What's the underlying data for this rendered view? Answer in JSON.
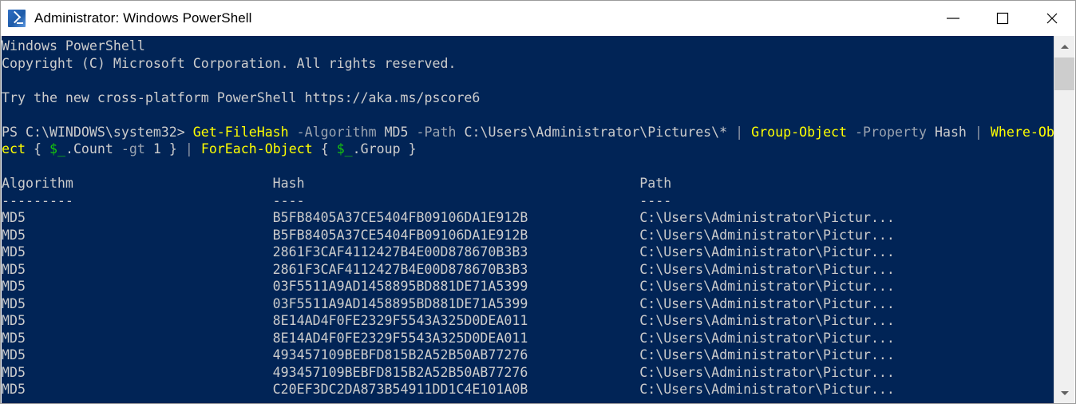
{
  "window": {
    "title": "Administrator: Windows PowerShell",
    "icon": "powershell-icon",
    "background_color": "#012456",
    "controls": {
      "minimize": "minimize-button",
      "maximize": "maximize-button",
      "close": "close-button"
    }
  },
  "colors": {
    "console_background": "#012456",
    "default_text": "#cccccc",
    "command": "#ffff00",
    "parameter": "#9aa3b0",
    "variable": "#16c60c",
    "titlebar_background": "#ffffff",
    "scrollbar_track": "#f0f0f0",
    "scrollbar_thumb": "#cdcdcd"
  },
  "console": {
    "banner": [
      "Windows PowerShell",
      "Copyright (C) Microsoft Corporation. All rights reserved.",
      "",
      "Try the new cross-platform PowerShell https://aka.ms/pscore6",
      ""
    ],
    "prompt": "PS C:\\WINDOWS\\system32>",
    "command_tokens": [
      {
        "text": " ",
        "style": "white"
      },
      {
        "text": "Get-FileHash",
        "style": "yellow"
      },
      {
        "text": " ",
        "style": "white"
      },
      {
        "text": "-Algorithm",
        "style": "gray"
      },
      {
        "text": " MD5 ",
        "style": "white"
      },
      {
        "text": "-Path",
        "style": "gray"
      },
      {
        "text": " C:\\Users\\Administrator\\Pictures\\* ",
        "style": "white"
      },
      {
        "text": "|",
        "style": "pipe"
      },
      {
        "text": " ",
        "style": "white"
      },
      {
        "text": "Group-Object",
        "style": "yellow"
      },
      {
        "text": " ",
        "style": "white"
      },
      {
        "text": "-Property",
        "style": "gray"
      },
      {
        "text": " Hash ",
        "style": "white"
      },
      {
        "text": "|",
        "style": "pipe"
      },
      {
        "text": " ",
        "style": "white"
      },
      {
        "text": "Where-Object",
        "style": "yellow"
      },
      {
        "text": " { ",
        "style": "white"
      },
      {
        "text": "$_",
        "style": "green"
      },
      {
        "text": ".Count ",
        "style": "white"
      },
      {
        "text": "-gt",
        "style": "gray"
      },
      {
        "text": " 1 } ",
        "style": "white"
      },
      {
        "text": "|",
        "style": "pipe"
      },
      {
        "text": " ",
        "style": "white"
      },
      {
        "text": "ForEach-Object",
        "style": "yellow"
      },
      {
        "text": " { ",
        "style": "white"
      },
      {
        "text": "$_",
        "style": "green"
      },
      {
        "text": ".Group }",
        "style": "white"
      }
    ],
    "blank_after_command": ""
  },
  "table": {
    "columns": [
      {
        "header": "Algorithm",
        "rule": "---------"
      },
      {
        "header": "Hash",
        "rule": "----"
      },
      {
        "header": "Path",
        "rule": "----"
      }
    ],
    "rows": [
      {
        "algorithm": "MD5",
        "hash": "B5FB8405A37CE5404FB09106DA1E912B",
        "path": "C:\\Users\\Administrator\\Pictur..."
      },
      {
        "algorithm": "MD5",
        "hash": "B5FB8405A37CE5404FB09106DA1E912B",
        "path": "C:\\Users\\Administrator\\Pictur..."
      },
      {
        "algorithm": "MD5",
        "hash": "2861F3CAF4112427B4E00D878670B3B3",
        "path": "C:\\Users\\Administrator\\Pictur..."
      },
      {
        "algorithm": "MD5",
        "hash": "2861F3CAF4112427B4E00D878670B3B3",
        "path": "C:\\Users\\Administrator\\Pictur..."
      },
      {
        "algorithm": "MD5",
        "hash": "03F5511A9AD1458895BD881DE71A5399",
        "path": "C:\\Users\\Administrator\\Pictur..."
      },
      {
        "algorithm": "MD5",
        "hash": "03F5511A9AD1458895BD881DE71A5399",
        "path": "C:\\Users\\Administrator\\Pictur..."
      },
      {
        "algorithm": "MD5",
        "hash": "8E14AD4F0FE2329F5543A325D0DEA011",
        "path": "C:\\Users\\Administrator\\Pictur..."
      },
      {
        "algorithm": "MD5",
        "hash": "8E14AD4F0FE2329F5543A325D0DEA011",
        "path": "C:\\Users\\Administrator\\Pictur..."
      },
      {
        "algorithm": "MD5",
        "hash": "493457109BEBFD815B2A52B50AB77276",
        "path": "C:\\Users\\Administrator\\Pictur..."
      },
      {
        "algorithm": "MD5",
        "hash": "493457109BEBFD815B2A52B50AB77276",
        "path": "C:\\Users\\Administrator\\Pictur..."
      },
      {
        "algorithm": "MD5",
        "hash": "C20EF3DC2DA873B54911DD1C4E101A0B",
        "path": "C:\\Users\\Administrator\\Pictur..."
      }
    ]
  },
  "scrollbar": {
    "up_arrow": "scroll-up-icon",
    "down_arrow": "scroll-down-icon",
    "thumb": "scrollbar-thumb"
  }
}
